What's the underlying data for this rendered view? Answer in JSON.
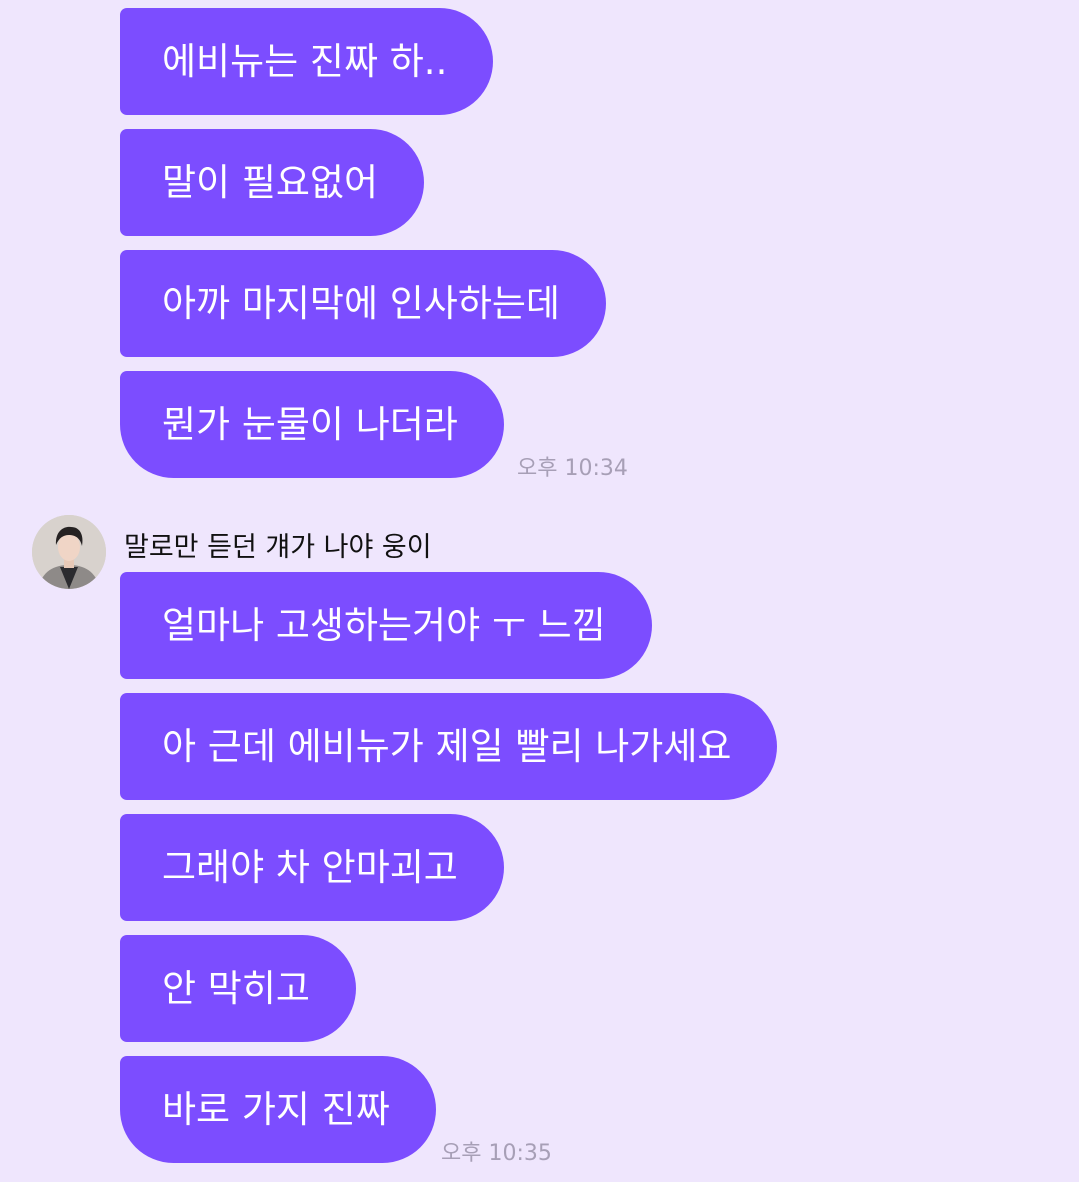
{
  "group1": {
    "messages": [
      "에비뉴는 진짜 하..",
      "말이 필요없어",
      "아까 마지막에 인사하는데",
      "뭔가 눈물이 나더라"
    ],
    "time": "오후 10:34"
  },
  "group2": {
    "sender": "말로만 듣던 걔가 나야 웅이",
    "messages": [
      "얼마나 고생하는거야 ㅜ 느낌",
      "아 근데 에비뉴가 제일 빨리 나가세요",
      "그래야 차 안마괴고",
      "안 막히고",
      "바로 가지 진짜"
    ],
    "time": "오후 10:35"
  },
  "colors": {
    "background": "#efe6fd",
    "bubble": "#7c4dff",
    "bubble_text": "#ffffff",
    "timestamp": "#a79fb6"
  }
}
